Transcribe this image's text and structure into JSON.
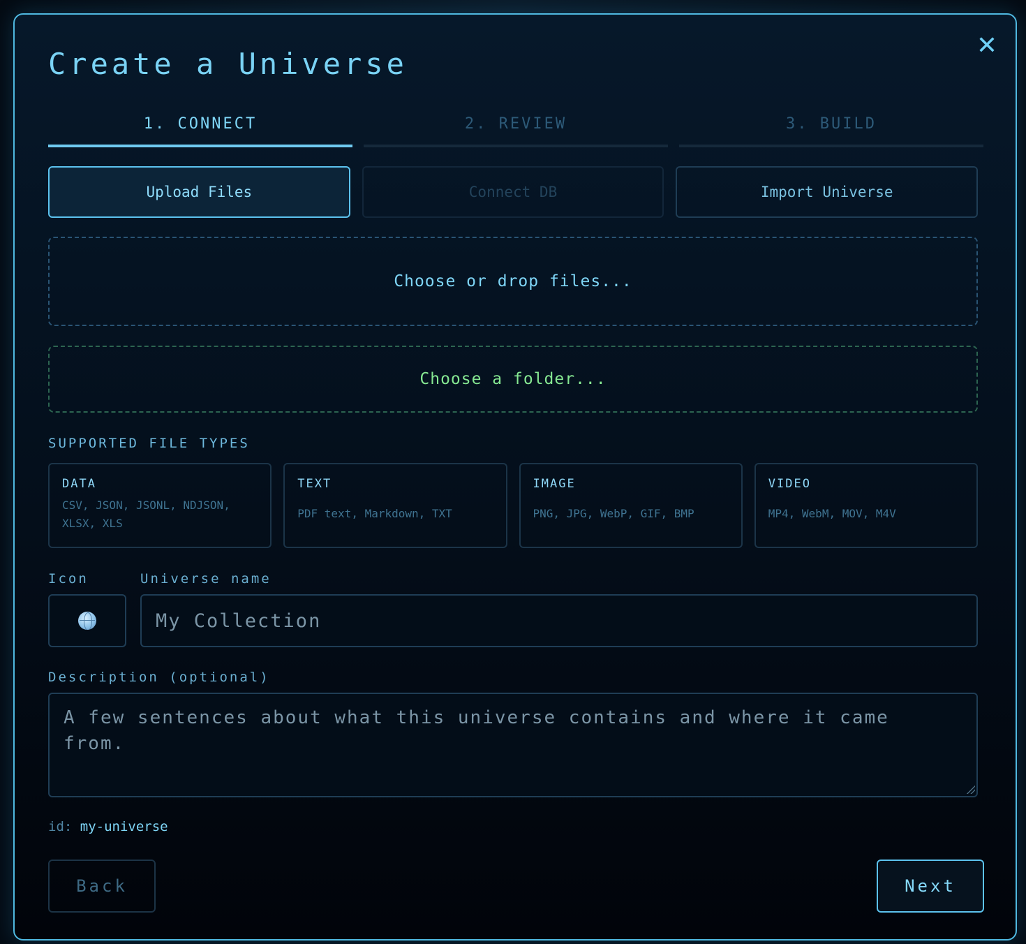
{
  "dialog": {
    "title": "Create a Universe",
    "close_glyph": "✕"
  },
  "steps": [
    {
      "label": "1. CONNECT",
      "active": true
    },
    {
      "label": "2. REVIEW",
      "active": false
    },
    {
      "label": "3. BUILD",
      "active": false
    }
  ],
  "modes": {
    "upload": "Upload Files",
    "connect_db": "Connect DB",
    "import": "Import Universe"
  },
  "dropzones": {
    "files": "Choose or drop files...",
    "folder": "Choose a folder..."
  },
  "supported": {
    "label": "SUPPORTED FILE TYPES",
    "types": [
      {
        "name": "DATA",
        "formats": "CSV, JSON, JSONL, NDJSON, XLSX, XLS"
      },
      {
        "name": "TEXT",
        "formats": "PDF text, Markdown, TXT"
      },
      {
        "name": "IMAGE",
        "formats": "PNG, JPG, WebP, GIF, BMP"
      },
      {
        "name": "VIDEO",
        "formats": "MP4, WebM, MOV, M4V"
      }
    ]
  },
  "form": {
    "icon_label": "Icon",
    "icon_name": "globe-icon",
    "name_label": "Universe name",
    "name_placeholder": "My Collection",
    "description_label": "Description (optional)",
    "description_placeholder": "A few sentences about what this universe contains and where it came from.",
    "id_prefix": "id:",
    "id_value": "my-universe"
  },
  "footer": {
    "back": "Back",
    "next": "Next"
  },
  "colors": {
    "accent": "#7fd6f7",
    "folder_accent": "#86e892",
    "border": "#1f3d55",
    "background": "#040e1a"
  }
}
